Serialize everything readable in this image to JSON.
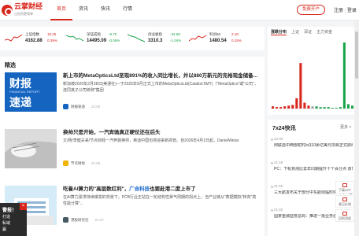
{
  "logo": {
    "name": "云掌财经",
    "tagline": "让投资更简单"
  },
  "nav": [
    {
      "label": "首页"
    },
    {
      "label": "资讯"
    },
    {
      "label": "快讯"
    },
    {
      "label": "行情"
    }
  ],
  "header": {
    "open_account": "免费开户",
    "login": "注册",
    "register": "登录"
  },
  "tickers": [
    {
      "name": "上证指数",
      "value": "4162.88",
      "change": "16.25",
      "pct": "0.39%",
      "dir": "up"
    },
    {
      "name": "深证成指",
      "value": "14495.09",
      "change": "-8.70",
      "pct": "-0.06%",
      "dir": "down"
    },
    {
      "name": "创业板指",
      "value": "3310.3",
      "change": "-34.68",
      "pct": "-1.04%",
      "dir": "down"
    },
    {
      "name": "科创50",
      "value": "1480.54",
      "change": "2.18",
      "pct": "0.15%",
      "dir": "up"
    }
  ],
  "feed": {
    "title": "精选"
  },
  "articles": [
    {
      "title_pre": "新上市的MetaOpticsLtd",
      "title_hl": "",
      "title_post": "至现891%的收入同比增长，并以880万新元的充裕现金储备...",
      "body": "新加坡2026年2月28日(美通社)—于2025年9月正式上市的MetaOpticsLtd(Catalist:9MT)（\"MetaOptics\"或\"公司\"，连同其子公司统称\"集团",
      "source": "财报速递",
      "time": "22:00",
      "thumb": {
        "line1": "财报",
        "line2": "速递",
        "sub": "FINANCIAL REPORT"
      }
    },
    {
      "title_pre": "换帅只是开始，一汽奔驰真正硬仗还在后头",
      "title_hl": "",
      "title_post": "",
      "body": "文/杨/李健夫来/节点财经一汽奔驰换帅，奥迪中国也将迎来新高管。自2026年4月1日起，DanielWeiss",
      "source": "节点财经",
      "time": "21:55"
    },
    {
      "title_pre": "吃着AI算力的\"高层数红利\"，",
      "title_hl": "广合科技",
      "title_post": "也要赴港二度上市了",
      "body": "在AI算力需求持续爆发的背景下，PCB行业正站在一轮结构性景气周期的拐点上，当产业链从\"数据模拟\"转向\"高性能计算\"...",
      "source": "港股研究社",
      "time": "21:27"
    }
  ],
  "right": {
    "tabs": [
      "涨跌分布",
      "上证",
      "深证",
      "主力资金"
    ],
    "bars": [
      3,
      2,
      2,
      3,
      4,
      5,
      14,
      62,
      8,
      4,
      3,
      3,
      2,
      2,
      2,
      1,
      1,
      2,
      90,
      6,
      4
    ],
    "bar_colors": {
      "up": "#d8261c",
      "down": "#1aa34a",
      "flat": "#9e9e9e"
    },
    "kx_title": "7x24快讯",
    "kx_more": "更多 >",
    "kx": [
      {
        "time": "22:00",
        "text": "阿联酋中西部蛇时间110余亿美元项目正式启动"
      },
      {
        "time": "21:59",
        "text": "PC：下机预测比去年同期提升十个百分点 该司内..."
      },
      {
        "time": "21:55",
        "text": "三大航发布关于部分中东航线临时停飞的公告"
      },
      {
        "time": "21:50",
        "text": "国家金融监管总局：推进一批业务创新试点"
      }
    ]
  },
  "tools": [
    "下载APP",
    "意见反馈",
    "回到顶部"
  ],
  "promo": {
    "title": "警报！",
    "line1": "打造",
    "line2": "私域",
    "line3": "赢"
  }
}
